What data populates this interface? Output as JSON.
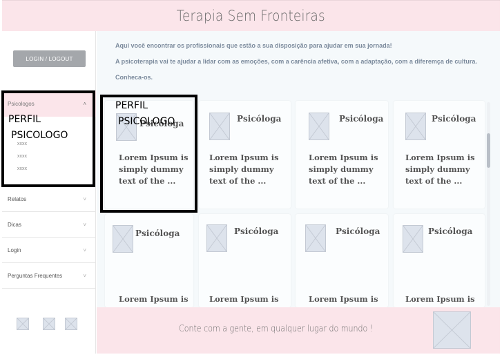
{
  "header": {
    "title": "Terapia Sem Fronteiras"
  },
  "sidebar": {
    "login_button": "LOGIN / LOGOUT",
    "psicologos": {
      "label": "Psicologos",
      "sub_items": [
        "xxxx",
        "xxxx",
        "xxxx"
      ]
    },
    "items": [
      {
        "label": "Relatos"
      },
      {
        "label": "Dicas"
      },
      {
        "label": "Login"
      },
      {
        "label": "Perguntas Frequentes"
      }
    ],
    "annotation": {
      "line1": "PERFIL",
      "line2": "PSICOLOGO"
    }
  },
  "main": {
    "intro": [
      "Aqui você encontrar os profissionais que estão a sua disposição para ajudar em sua jornada!",
      "A psicoterapia vai te ajudar a lidar com as emoções, com a carência afetiva, com a adaptação, com a diferemça de cultura.",
      "Conheca-os."
    ],
    "cards": [
      {
        "title": "Psicóloga",
        "text": "Lorem Ipsum is simply dummy text of the ..."
      },
      {
        "title": "Psicóloga",
        "text": "Lorem Ipsum is simply dummy text of the ..."
      },
      {
        "title": "Psicóloga",
        "text": "Lorem Ipsum is simply dummy text of the ..."
      },
      {
        "title": "Psicóloga",
        "text": "Lorem Ipsum is simply dummy text of the ..."
      },
      {
        "title": "Psicóloga",
        "text": "Lorem Ipsum is"
      },
      {
        "title": "Psicóloga",
        "text": "Lorem Ipsum is"
      },
      {
        "title": "Psicóloga",
        "text": "Lorem Ipsum is"
      },
      {
        "title": "Psicóloga",
        "text": "Lorem Ipsum is"
      }
    ],
    "annotation": {
      "line1": "PERFIL",
      "line2": "PSICOLOGO"
    }
  },
  "footer": {
    "message": "Conte com a gente, em qualquer lugar do mundo !"
  }
}
